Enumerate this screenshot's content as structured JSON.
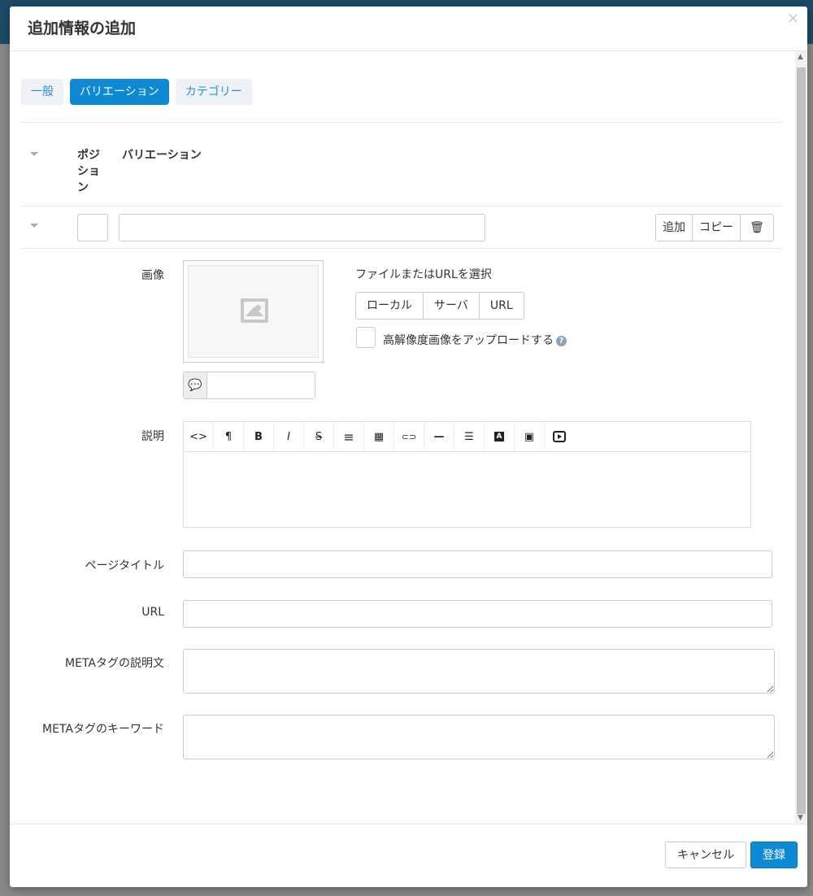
{
  "modal": {
    "title": "追加情報の追加",
    "close_label": "×"
  },
  "tabs": [
    {
      "label": "一般",
      "active": false
    },
    {
      "label": "バリエーション",
      "active": true
    },
    {
      "label": "カテゴリー",
      "active": false
    }
  ],
  "table": {
    "position_header": "ポジション",
    "variation_header": "バリエーション",
    "row": {
      "position_value": "",
      "variation_value": "",
      "add_label": "追加",
      "copy_label": "コピー",
      "delete_icon": "trash-icon"
    }
  },
  "image": {
    "label": "画像",
    "select_text": "ファイルまたはURLを選択",
    "source_buttons": [
      "ローカル",
      "サーバ",
      "URL"
    ],
    "hires_label": "高解像度画像をアップロードする",
    "alt_value": ""
  },
  "description": {
    "label": "説明",
    "toolbar_icons": [
      "code-icon",
      "paragraph-icon",
      "bold-icon",
      "italic-icon",
      "strikethrough-icon",
      "list-icon",
      "table-icon",
      "link-icon",
      "horizontal-rule-icon",
      "align-icon",
      "font-color-icon",
      "image-icon",
      "video-icon"
    ],
    "toolbar_glyphs": [
      "<>",
      "¶",
      "B",
      "I",
      "S",
      "≡",
      "▦",
      "⊂⊃",
      "—",
      "☰",
      "A",
      "▣",
      "▷"
    ]
  },
  "fields": {
    "page_title_label": "ページタイトル",
    "url_label": "URL",
    "meta_description_label": "METAタグの説明文",
    "meta_keywords_label": "METAタグのキーワード"
  },
  "footer": {
    "cancel_label": "キャンセル",
    "submit_label": "登録"
  },
  "colors": {
    "primary": "#0d8ad3",
    "tab_bg": "#eef1f5"
  }
}
